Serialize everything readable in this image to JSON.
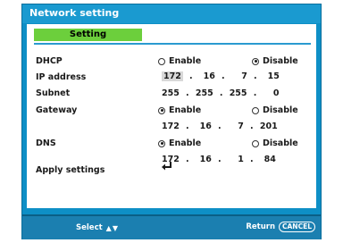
{
  "window": {
    "title": "Network setting"
  },
  "tab": {
    "label": "Setting"
  },
  "dhcp": {
    "label": "DHCP",
    "options": [
      {
        "label": "Enable",
        "selected": false
      },
      {
        "label": "Disable",
        "selected": true
      }
    ]
  },
  "ip_address": {
    "label": "IP address",
    "octets": [
      "172",
      "16",
      "7",
      "15"
    ],
    "active_octet": 0
  },
  "subnet": {
    "label": "Subnet",
    "octets": [
      "255",
      "255",
      "255",
      "0"
    ]
  },
  "gateway": {
    "label": "Gateway",
    "options": [
      {
        "label": "Enable",
        "selected": true
      },
      {
        "label": "Disable",
        "selected": false
      }
    ],
    "octets": [
      "172",
      "16",
      "7",
      "201"
    ]
  },
  "dns": {
    "label": "DNS",
    "options": [
      {
        "label": "Enable",
        "selected": true
      },
      {
        "label": "Disable",
        "selected": false
      }
    ],
    "octets": [
      "172",
      "16",
      "1",
      "84"
    ]
  },
  "apply": {
    "label": "Apply settings",
    "icon": "enter-icon"
  },
  "footer": {
    "select_label": "Select",
    "select_icon": "up-down-arrows-icon",
    "return_label": "Return",
    "cancel_key": "CANCEL"
  },
  "colors": {
    "panel": "#0e8fc6",
    "title_bar": "#1a9ad0",
    "tab": "#6ccf3c",
    "footer": "#1b7fb0",
    "content": "#ffffff"
  }
}
